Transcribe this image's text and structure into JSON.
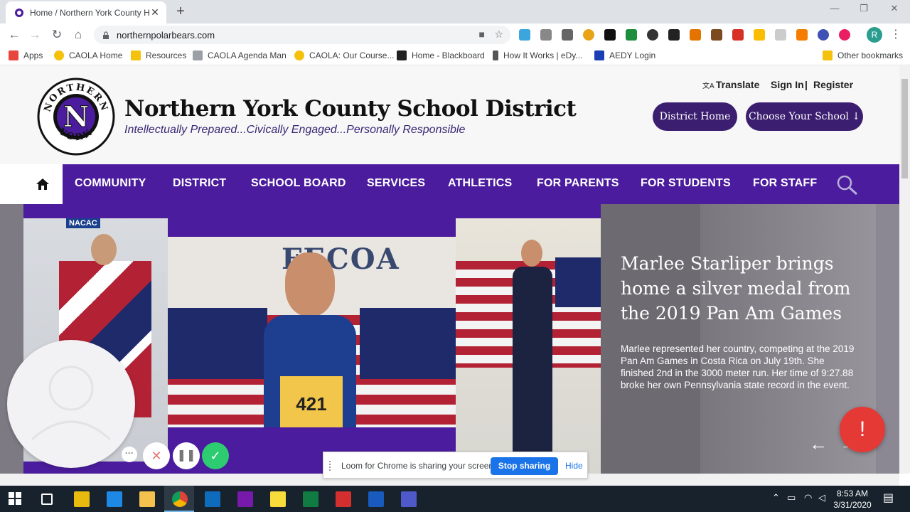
{
  "browser": {
    "tab_title": "Home / Northern York County H",
    "url": "northernpolarbears.com",
    "bookmarks": [
      {
        "label": "Apps",
        "color": "#e8453c"
      },
      {
        "label": "CAOLA Home",
        "color": "#f4c20d"
      },
      {
        "label": "Resources",
        "color": "#f4c20d"
      },
      {
        "label": "CAOLA Agenda Man",
        "color": "#9aa0a6"
      },
      {
        "label": "CAOLA: Our Course...",
        "color": "#f4c20d"
      },
      {
        "label": "Home - Blackboard",
        "color": "#222222"
      },
      {
        "label": "How It Works | eDy...",
        "color": "#555555"
      },
      {
        "label": "AEDY Login",
        "color": "#1a3fb5"
      }
    ],
    "other_bookmarks": "Other bookmarks",
    "profile_initial": "R"
  },
  "site": {
    "district_name": "Northern York County School District",
    "tagline": "Intellectually Prepared...Civically Engaged...Personally Responsible",
    "seal_top": "NORTHERN",
    "seal_bottom": "YORK",
    "seal_letter": "N",
    "translate": "Translate",
    "sign_in": "Sign In",
    "separator": "|",
    "register": "Register",
    "district_home": "District Home",
    "choose_school": "Choose Your School ↓",
    "nav": [
      "COMMUNITY",
      "DISTRICT",
      "SCHOOL BOARD",
      "SERVICES",
      "ATHLETICS",
      "FOR PARENTS",
      "FOR STUDENTS",
      "FOR STAFF"
    ],
    "brand_color": "#4b1c9e"
  },
  "slide": {
    "title": "Marlee Starliper brings home a silver medal from the 2019 Pan Am Games",
    "body": "Marlee represented her country, competing at the 2019 Pan Am Games in Costa Rica on July 19th. She finished 2nd in the 3000 meter run. Her time of 9:27.88 broke her own Pennsylvania state record in the event.",
    "photo_sign": "NACAC",
    "photo_banner": "FECOA",
    "bib_number": "421"
  },
  "overlays": {
    "share_message": "Loom for Chrome is sharing your screen.",
    "stop_sharing": "Stop sharing",
    "hide": "Hide",
    "alert": "!"
  },
  "taskbar": {
    "time": "8:53 AM",
    "date": "3/31/2020"
  }
}
